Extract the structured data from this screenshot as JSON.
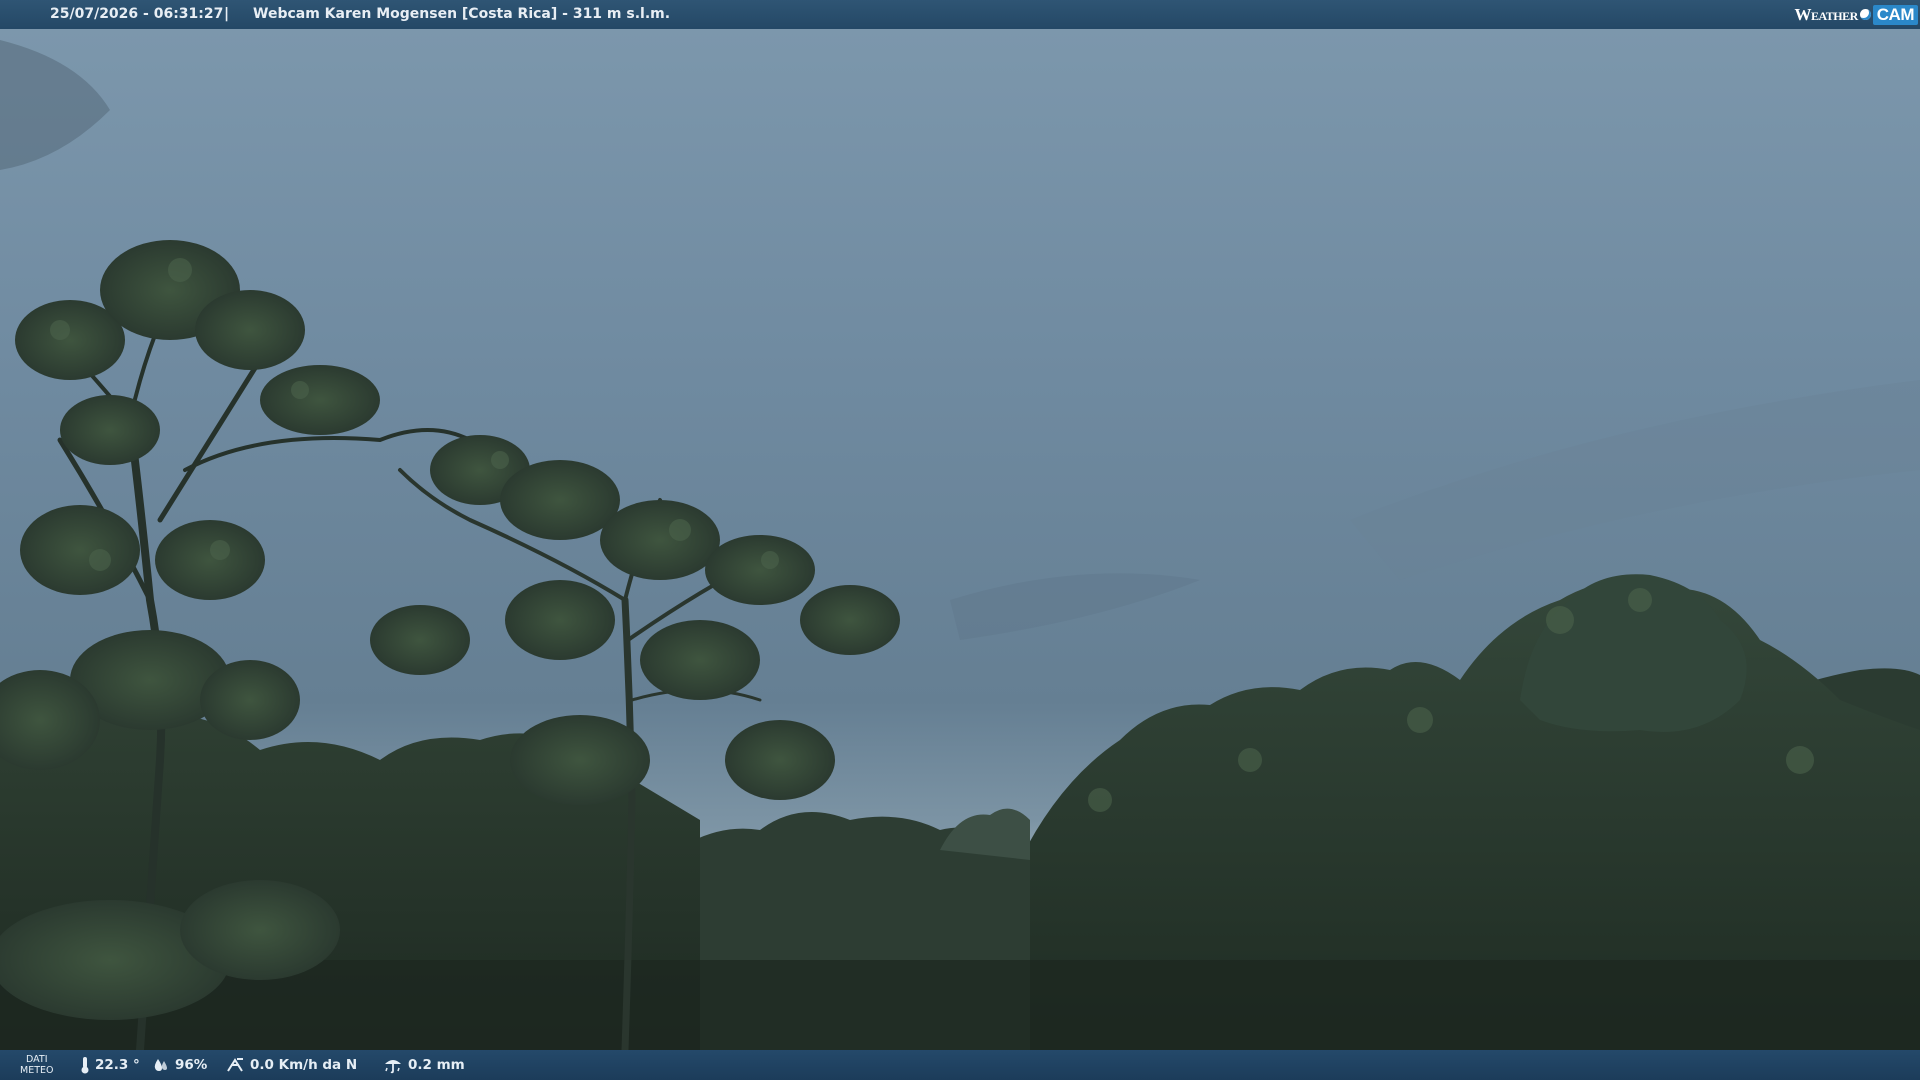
{
  "header": {
    "timestamp": "25/07/2026 - 06:31:27",
    "separator": "|",
    "title": "Webcam Karen Mogensen [Costa Rica]  - 311 m s.l.m."
  },
  "logo": {
    "weather": "Weather",
    "cam": "CAM"
  },
  "footer": {
    "dati_line1": "DATI",
    "dati_line2": "METEO",
    "temperature": "22.3 °",
    "humidity": "96%",
    "wind": "0.0 Km/h da N",
    "rain": "0.2 mm"
  },
  "icons": {
    "temperature": "thermometer-icon",
    "humidity": "drops-icon",
    "wind": "wind-icon",
    "rain": "rain-icon"
  },
  "colors": {
    "bar_top": "#2f5574",
    "bar_bottom": "#1c3c5a",
    "logo_accent": "#2b88c9"
  }
}
